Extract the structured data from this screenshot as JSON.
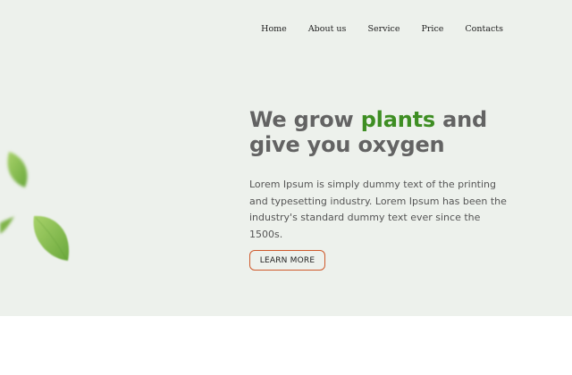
{
  "nav": {
    "items": [
      "Home",
      "About us",
      "Service",
      "Price",
      "Contacts"
    ]
  },
  "hero": {
    "headline_part1": "We grow ",
    "headline_accent": "plants",
    "headline_part2": " and give you oxygen",
    "body": "Lorem Ipsum is simply dummy text of the printing and typesetting industry. Lorem Ipsum has been the industry's standard dummy text ever since the 1500s.",
    "cta_label": "LEARN MORE"
  },
  "colors": {
    "hero_background": "#edf1ec",
    "headline": "#636363",
    "accent": "#3e8e23",
    "button_border": "#cf5a2c",
    "leaf": "#8cc152"
  },
  "icons": {
    "decoration": "leaf-icon"
  }
}
